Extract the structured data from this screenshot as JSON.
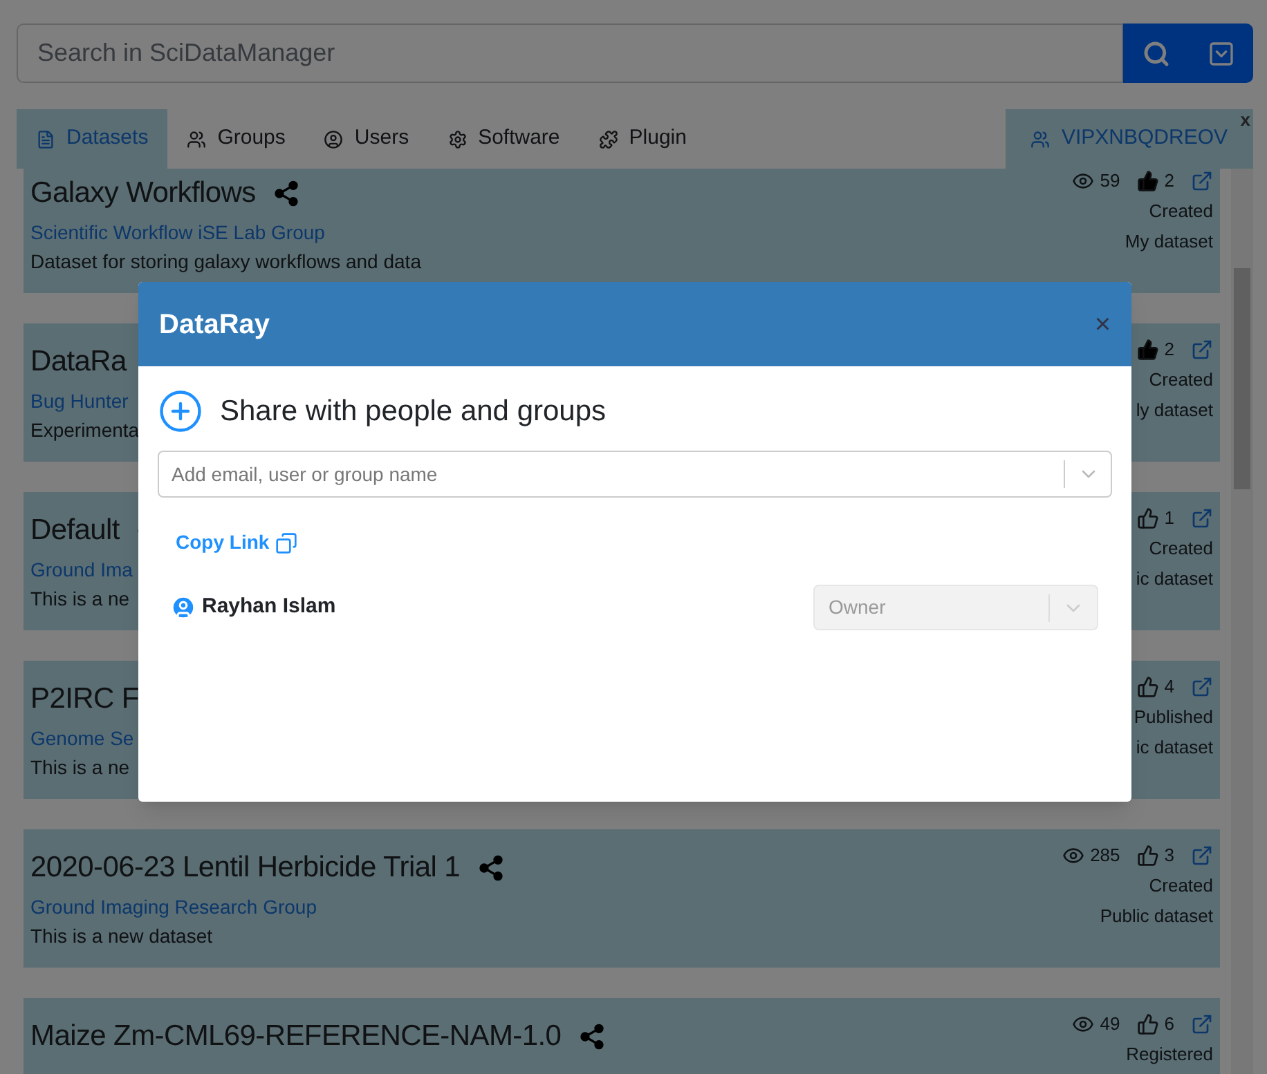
{
  "search": {
    "placeholder": "Search in SciDataManager"
  },
  "tabs": [
    {
      "label": "Datasets",
      "selected": true
    },
    {
      "label": "Groups",
      "selected": false
    },
    {
      "label": "Users",
      "selected": false
    },
    {
      "label": "Software",
      "selected": false
    },
    {
      "label": "Plugin",
      "selected": false
    }
  ],
  "open_group": {
    "label": "VIPXNBQDREOV",
    "close": "x"
  },
  "datasets": [
    {
      "title": "Galaxy Workflows",
      "group": "Scientific Workflow iSE Lab Group",
      "description": "Dataset for storing galaxy workflows and data",
      "views": "59",
      "likes": "2",
      "liked": true,
      "status": "Created",
      "visibility": "My dataset"
    },
    {
      "title": "DataRa",
      "group": "Bug Hunter",
      "description": "Experimenta",
      "likes": "2",
      "liked": true,
      "status": "Created",
      "visibility": "ly dataset"
    },
    {
      "title": "Default",
      "group": "Ground Ima",
      "description": "This is a ne",
      "likes": "1",
      "liked": false,
      "status": "Created",
      "visibility": "ic dataset"
    },
    {
      "title": "P2IRC F",
      "group": "Genome Se",
      "description": "This is a ne",
      "likes": "4",
      "liked": false,
      "status": "Published",
      "visibility": "ic dataset"
    },
    {
      "title": "2020-06-23 Lentil Herbicide Trial 1",
      "group": "Ground Imaging Research Group",
      "description": "This is a new dataset",
      "views": "285",
      "likes": "3",
      "liked": false,
      "status": "Created",
      "visibility": "Public dataset"
    },
    {
      "title": "Maize Zm-CML69-REFERENCE-NAM-1.0",
      "views": "49",
      "likes": "6",
      "liked": false,
      "status": "Registered"
    }
  ],
  "dialog": {
    "title": "DataRay",
    "close": "×",
    "heading": "Share with people and groups",
    "input": {
      "placeholder": "Add email, user or group name"
    },
    "copy_link": "Copy Link",
    "members": [
      {
        "name": "Rayhan Islam",
        "role": "Owner",
        "disabled": true
      }
    ]
  }
}
